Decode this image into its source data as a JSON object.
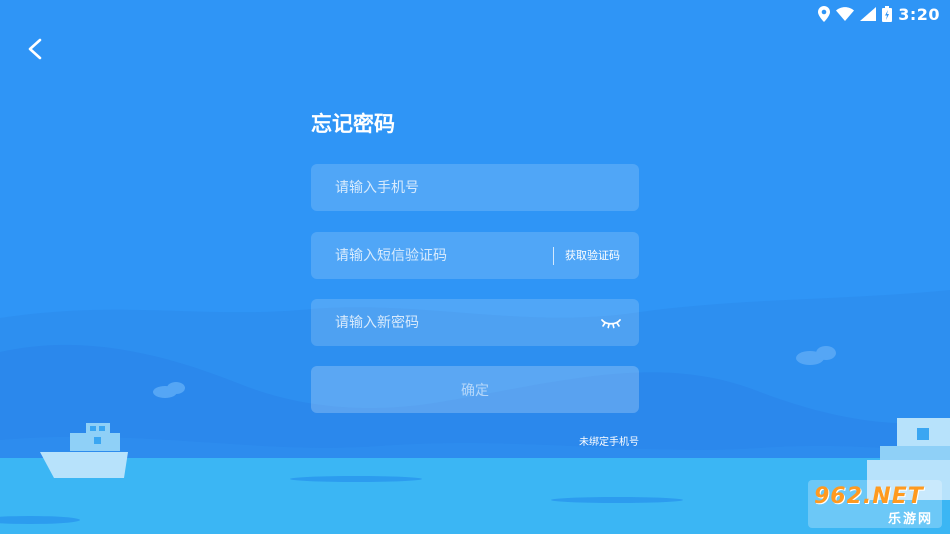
{
  "status_bar": {
    "time": "3:20",
    "icons": [
      "location-icon",
      "wifi-icon",
      "signal-icon",
      "battery-icon"
    ]
  },
  "nav": {
    "back_icon": "chevron-left-icon"
  },
  "title": "忘记密码",
  "form": {
    "phone_placeholder": "请输入手机号",
    "phone_value": "",
    "sms_placeholder": "请输入短信验证码",
    "sms_value": "",
    "sms_button": "获取验证码",
    "password_placeholder": "请输入新密码",
    "password_value": "",
    "password_toggle_icon": "eye-closed-icon",
    "confirm_label": "确定",
    "unbound_link": "未绑定手机号"
  },
  "watermark": {
    "top_text": "962.NET",
    "bottom_text": "乐游网"
  },
  "colors": {
    "background": "#2f95f6",
    "sea": "#3bb6f4",
    "text": "#ffffff",
    "watermark_accent": "#ff9a1f"
  }
}
